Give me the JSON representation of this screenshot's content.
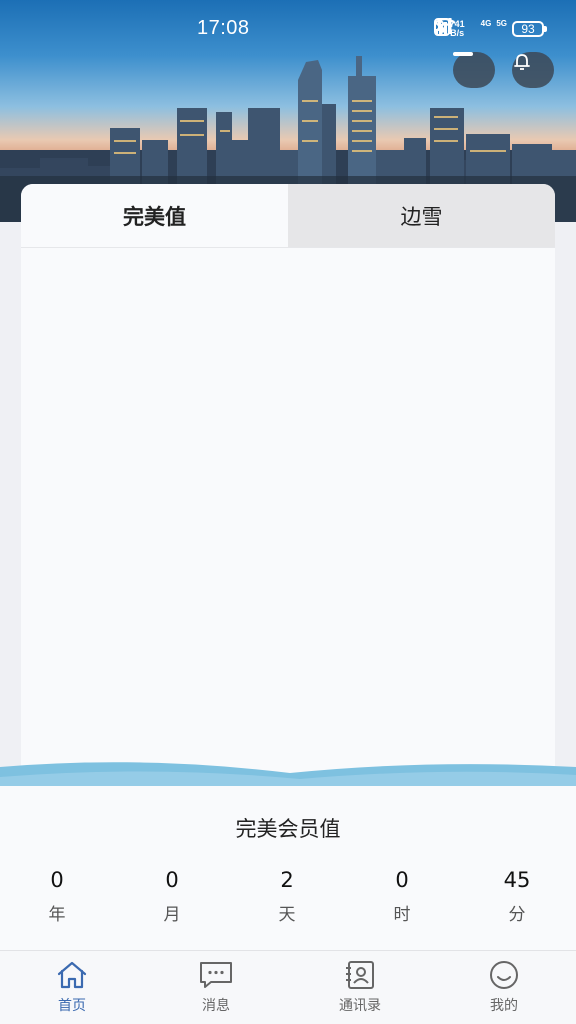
{
  "status_bar": {
    "time": "17:08",
    "net_speed_value": "741",
    "net_speed_unit": "B/s",
    "sim1": "4G",
    "sim2": "5G",
    "battery": "93",
    "icons": [
      "nfc-icon",
      "bluetooth-icon",
      "wifi-icon",
      "signal-icon",
      "signal-icon",
      "battery-icon"
    ]
  },
  "header": {
    "buttons": [
      "minimize-icon",
      "bell-icon"
    ]
  },
  "tabs": [
    {
      "label": "完美值",
      "active": true
    },
    {
      "label": "边雪",
      "active": false
    }
  ],
  "counter": {
    "title": "完美会员值",
    "units": [
      {
        "value": "0",
        "label": "年"
      },
      {
        "value": "0",
        "label": "月"
      },
      {
        "value": "2",
        "label": "天"
      },
      {
        "value": "0",
        "label": "时"
      },
      {
        "value": "45",
        "label": "分"
      }
    ]
  },
  "bottom_nav": [
    {
      "label": "首页",
      "icon": "home-icon",
      "active": true
    },
    {
      "label": "消息",
      "icon": "message-icon",
      "active": false
    },
    {
      "label": "通讯录",
      "icon": "contacts-icon",
      "active": false
    },
    {
      "label": "我的",
      "icon": "smile-icon",
      "active": false
    }
  ],
  "colors": {
    "accent": "#3b6ab0",
    "wave": "#7ec1e0",
    "card": "#f9fafc",
    "inactive_tab": "#e6e6e8"
  }
}
